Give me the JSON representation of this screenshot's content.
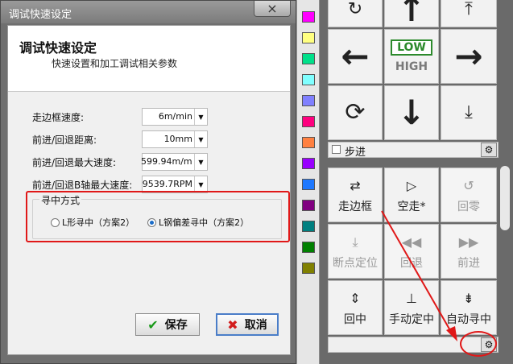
{
  "dialog": {
    "title": "调试快速设定",
    "close_icon": "×",
    "header_title": "调试快速设定",
    "header_subtitle": "快速设置和加工调试相关参数",
    "fields": [
      {
        "label": "走边框速度:",
        "value": "6m/min"
      },
      {
        "label": "前进/回退距离:",
        "value": "10mm"
      },
      {
        "label": "前进/回退最大速度:",
        "value": "599.94m/min"
      },
      {
        "label": "前进/回退B轴最大速度:",
        "value": "9539.7RPM"
      }
    ],
    "center_group": {
      "label": "寻中方式",
      "options": [
        {
          "label": "L形寻中（方案2）",
          "selected": false
        },
        {
          "label": "L钢偏差寻中（方案2）",
          "selected": true
        }
      ]
    },
    "save_label": "保存",
    "cancel_label": "取消"
  },
  "palette": {
    "colors": [
      "#ff00ff",
      "#ffff80",
      "#00e08a",
      "#80ffff",
      "#8080ff",
      "#ff007f",
      "#ff8040",
      "#9900ff",
      "#1e78ff",
      "#800080",
      "#008080",
      "#008000",
      "#808000"
    ]
  },
  "jog_panel": {
    "low_label": "LOW",
    "high_label": "HIGH",
    "step_label": "步进"
  },
  "action_panel": {
    "buttons": [
      {
        "label": "走边框",
        "icon": "frame-icon",
        "enabled": true
      },
      {
        "label": "空走*",
        "icon": "play-icon",
        "enabled": true
      },
      {
        "label": "回零",
        "icon": "home-icon",
        "enabled": false
      },
      {
        "label": "断点定位",
        "icon": "breakpoint-icon",
        "enabled": false
      },
      {
        "label": "回退",
        "icon": "rewind-icon",
        "enabled": false
      },
      {
        "label": "前进",
        "icon": "forward-icon",
        "enabled": false
      },
      {
        "label": "回中",
        "icon": "center-icon",
        "enabled": true
      },
      {
        "label": "手动定中",
        "icon": "manual-center-icon",
        "enabled": true
      },
      {
        "label": "自动寻中",
        "icon": "auto-center-icon",
        "enabled": true
      }
    ]
  },
  "annotation_colors": {
    "highlight": "#e01818"
  }
}
